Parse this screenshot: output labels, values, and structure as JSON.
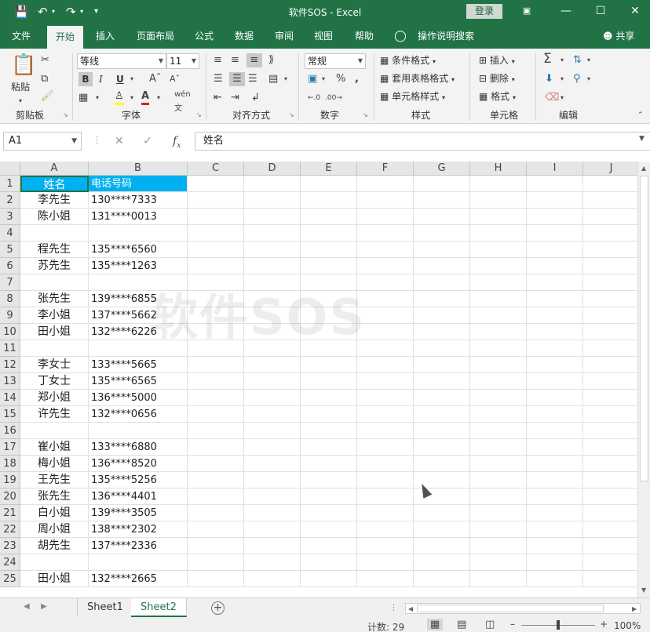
{
  "window": {
    "title": "软件SOS  -  Excel",
    "login_label": "登录"
  },
  "menu": {
    "tabs": [
      "文件",
      "开始",
      "插入",
      "页面布局",
      "公式",
      "数据",
      "审阅",
      "视图",
      "帮助"
    ],
    "active_tab": "开始",
    "tell_me": "操作说明搜索",
    "share": "共享"
  },
  "ribbon": {
    "clipboard": {
      "paste": "粘贴",
      "label": "剪贴板"
    },
    "font": {
      "name": "等线",
      "size": "11",
      "label": "字体",
      "bold": "B",
      "italic": "I",
      "underline": "U"
    },
    "alignment": {
      "label": "对齐方式"
    },
    "number": {
      "format": "常规",
      "label": "数字"
    },
    "styles": {
      "conditional": "条件格式",
      "table": "套用表格格式",
      "cell_styles": "单元格样式",
      "label": "样式"
    },
    "cells": {
      "insert": "插入",
      "delete": "删除",
      "format": "格式",
      "label": "单元格"
    },
    "editing": {
      "label": "编辑"
    }
  },
  "formula_bar": {
    "name_box": "A1",
    "content": "姓名"
  },
  "columns": [
    "A",
    "B",
    "C",
    "D",
    "E",
    "F",
    "G",
    "H",
    "I",
    "J"
  ],
  "rows": [
    {
      "n": "1",
      "a": "姓名",
      "b": "电话号码"
    },
    {
      "n": "2",
      "a": "李先生",
      "b": "130****7333"
    },
    {
      "n": "3",
      "a": "陈小姐",
      "b": "131****0013"
    },
    {
      "n": "4",
      "a": "",
      "b": ""
    },
    {
      "n": "5",
      "a": "程先生",
      "b": "135****6560"
    },
    {
      "n": "6",
      "a": "苏先生",
      "b": "135****1263"
    },
    {
      "n": "7",
      "a": "",
      "b": ""
    },
    {
      "n": "8",
      "a": "张先生",
      "b": "139****6855"
    },
    {
      "n": "9",
      "a": "李小姐",
      "b": "137****5662"
    },
    {
      "n": "10",
      "a": "田小姐",
      "b": "132****6226"
    },
    {
      "n": "11",
      "a": "",
      "b": ""
    },
    {
      "n": "12",
      "a": "李女士",
      "b": "133****5665"
    },
    {
      "n": "13",
      "a": "丁女士",
      "b": "135****6565"
    },
    {
      "n": "14",
      "a": "郑小姐",
      "b": "136****5000"
    },
    {
      "n": "15",
      "a": "许先生",
      "b": "132****0656"
    },
    {
      "n": "16",
      "a": "",
      "b": ""
    },
    {
      "n": "17",
      "a": "崔小姐",
      "b": "133****6880"
    },
    {
      "n": "18",
      "a": "梅小姐",
      "b": "136****8520"
    },
    {
      "n": "19",
      "a": "王先生",
      "b": "135****5256"
    },
    {
      "n": "20",
      "a": "张先生",
      "b": "136****4401"
    },
    {
      "n": "21",
      "a": "白小姐",
      "b": "139****3505"
    },
    {
      "n": "22",
      "a": "周小姐",
      "b": "138****2302"
    },
    {
      "n": "23",
      "a": "胡先生",
      "b": "137****2336"
    },
    {
      "n": "24",
      "a": "",
      "b": ""
    },
    {
      "n": "25",
      "a": "田小姐",
      "b": "132****2665"
    }
  ],
  "watermark": "软件SOS",
  "sheets": [
    "Sheet1",
    "Sheet2"
  ],
  "active_sheet": "Sheet2",
  "status": {
    "count": "计数: 29",
    "zoom": "100%"
  },
  "colors": {
    "brand": "#217346",
    "header_fill": "#00b0f0"
  }
}
